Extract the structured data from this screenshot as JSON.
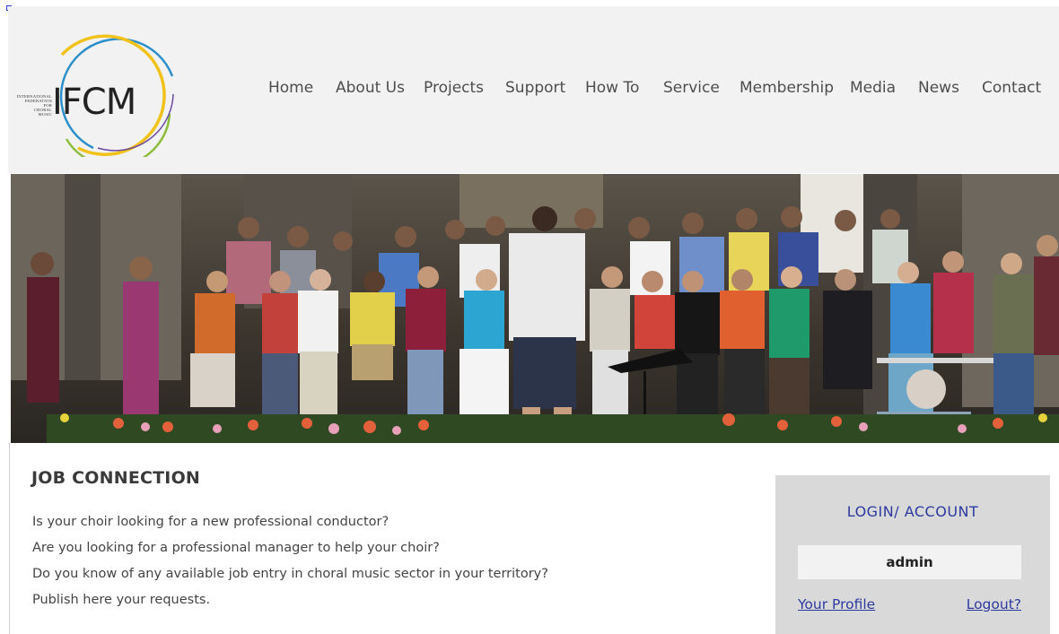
{
  "logo": {
    "name": "IFCM",
    "small_text": [
      "INTERNATIONAL",
      "FEDERATION",
      "FOR",
      "CHORAL",
      "MUSIC"
    ],
    "ring_colors": [
      "#2c8fc9",
      "#f0c21a",
      "#8bbd3a"
    ]
  },
  "nav": {
    "items": [
      {
        "label": "Home"
      },
      {
        "label": "About Us"
      },
      {
        "label": "Projects"
      },
      {
        "label": "Support"
      },
      {
        "label": "How To"
      },
      {
        "label": "Service"
      },
      {
        "label": "Membership"
      },
      {
        "label": "Media"
      },
      {
        "label": "News"
      },
      {
        "label": "Contact"
      }
    ]
  },
  "job": {
    "title": "JOB CONNECTION",
    "lines": [
      "Is your choir looking for a new professional conductor?",
      "Are you looking for a professional manager to help your choir?",
      "Do you know of any available job entry in choral music sector in your territory?",
      "Publish here your requests."
    ]
  },
  "login": {
    "title": "LOGIN/ ACCOUNT",
    "username": "admin",
    "profile_label": "Your Profile",
    "logout_label": "Logout?"
  },
  "colors": {
    "link": "#2c3a9e",
    "header_bg": "#f2f2f2",
    "panel_bg": "#d9d9d9"
  }
}
